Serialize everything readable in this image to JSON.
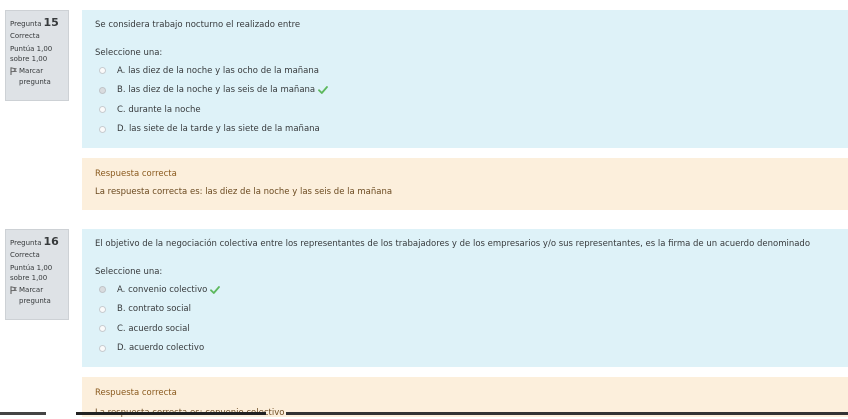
{
  "questions": [
    {
      "label": "Pregunta",
      "number": "15",
      "state": "Correcta",
      "grade_line1": "Puntúa 1,00",
      "grade_line2": "sobre 1,00",
      "flag_line1": "Marcar",
      "flag_line2": "pregunta",
      "text": "Se considera trabajo nocturno el realizado entre",
      "prompt": "Seleccione una:",
      "answers": [
        {
          "label": "A. las diez de la noche y las ocho de la mañana",
          "selected": false,
          "correct": false
        },
        {
          "label": "B. las diez de la noche y las seis de la mañana",
          "selected": true,
          "correct": true
        },
        {
          "label": "C. durante la noche",
          "selected": false,
          "correct": false
        },
        {
          "label": "D. las siete de la tarde y las siete de la mañana",
          "selected": false,
          "correct": false
        }
      ],
      "feedback_title": "Respuesta correcta",
      "feedback_answer": "La respuesta correcta es: las diez de la noche y las seis de la mañana"
    },
    {
      "label": "Pregunta",
      "number": "16",
      "state": "Correcta",
      "grade_line1": "Puntúa 1,00",
      "grade_line2": "sobre 1,00",
      "flag_line1": "Marcar",
      "flag_line2": "pregunta",
      "text": "El objetivo de la negociación colectiva entre los representantes de los trabajadores y de los empresarios y/o sus representantes, es la firma de un acuerdo denominado",
      "prompt": "Seleccione una:",
      "answers": [
        {
          "label": "A. convenio colectivo",
          "selected": true,
          "correct": true
        },
        {
          "label": "B. contrato social",
          "selected": false,
          "correct": false
        },
        {
          "label": "C. acuerdo social",
          "selected": false,
          "correct": false
        },
        {
          "label": "D. acuerdo colectivo",
          "selected": false,
          "correct": false
        }
      ],
      "feedback_title": "Respuesta correcta",
      "feedback_answer": "La respuesta correcta es: convenio colectivo"
    }
  ],
  "colors": {
    "question_bg": "#def2f8",
    "feedback_bg": "#fcefdc",
    "info_bg": "#dee2e6",
    "check": "#5cb85c"
  },
  "icons": {
    "flag": "flag-icon",
    "correct": "check-icon"
  }
}
